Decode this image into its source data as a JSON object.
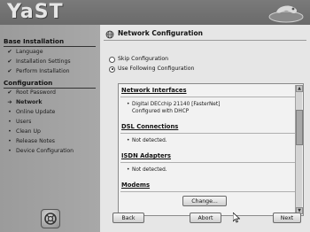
{
  "header": {
    "logo": "YaST"
  },
  "sidebar": {
    "base_title": "Base Installation",
    "base_steps": [
      {
        "mark": "✔",
        "label": "Language"
      },
      {
        "mark": "✔",
        "label": "Installation Settings"
      },
      {
        "mark": "✔",
        "label": "Perform Installation"
      }
    ],
    "config_title": "Configuration",
    "config_steps": [
      {
        "mark": "✔",
        "label": "Root Password"
      },
      {
        "mark": "➔",
        "label": "Network"
      },
      {
        "mark": "•",
        "label": "Online Update"
      },
      {
        "mark": "•",
        "label": "Users"
      },
      {
        "mark": "•",
        "label": "Clean Up"
      },
      {
        "mark": "•",
        "label": "Release Notes"
      },
      {
        "mark": "•",
        "label": "Device Configuration"
      }
    ]
  },
  "main": {
    "title": "Network Configuration",
    "radios": [
      {
        "label": "Skip Configuration",
        "selected": false
      },
      {
        "label": "Use Following Configuration",
        "selected": true
      }
    ],
    "overview": {
      "sections": [
        {
          "heading": "Network Interfaces",
          "items": [
            "Digital DECchip 21140 [FasterNet]"
          ],
          "sub": "Configured with DHCP"
        },
        {
          "heading": "DSL Connections",
          "items": [
            "Not detected."
          ]
        },
        {
          "heading": "ISDN Adapters",
          "items": [
            "Not detected."
          ]
        },
        {
          "heading": "Modems",
          "items": []
        }
      ]
    },
    "buttons": {
      "change": "Change...",
      "back": "Back",
      "abort": "Abort",
      "next": "Next"
    }
  }
}
